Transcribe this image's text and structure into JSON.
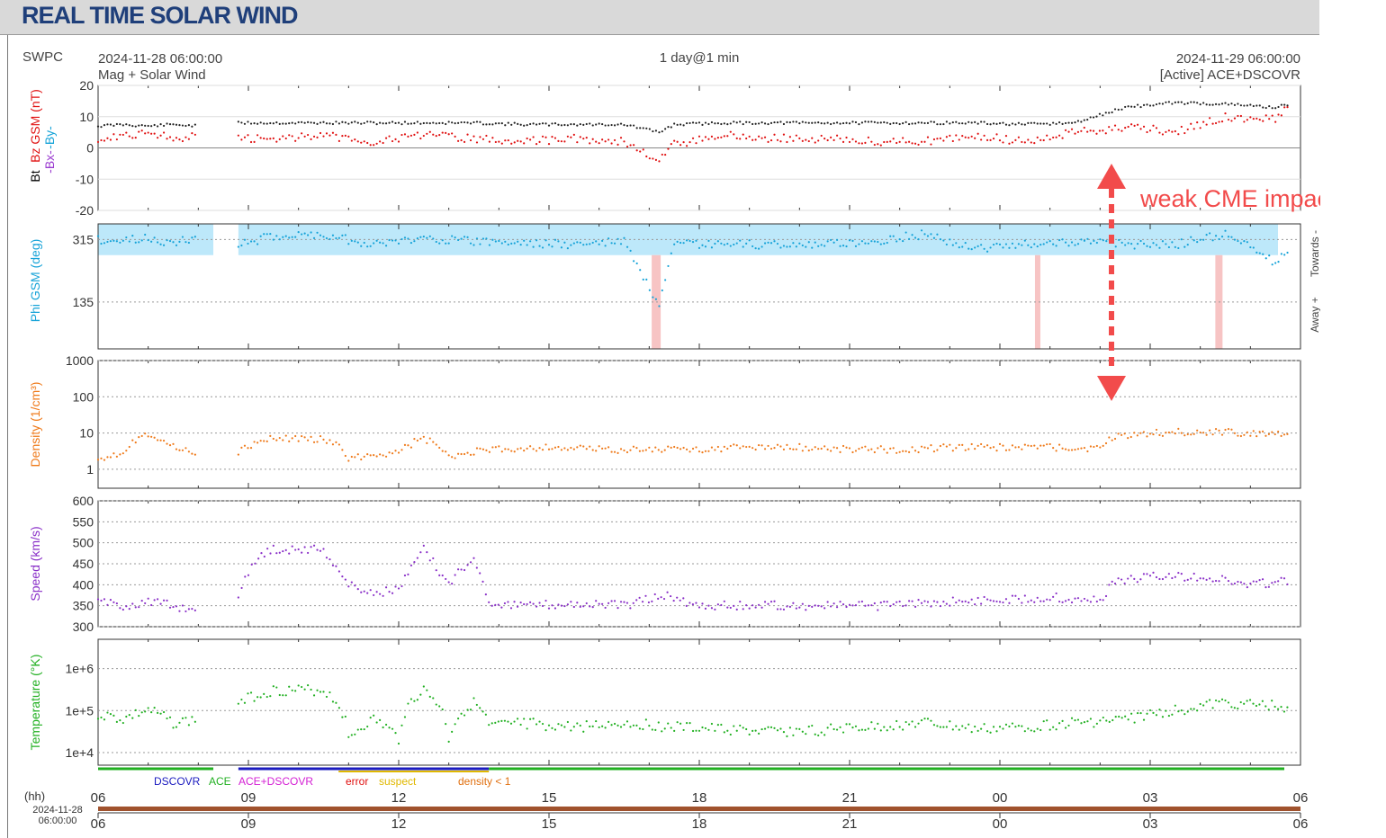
{
  "header": {
    "title": "REAL TIME SOLAR WIND"
  },
  "top": {
    "left": "SWPC",
    "start": "2024-11-28 06:00:00",
    "subtitle": "Mag + Solar Wind",
    "center": "1 day@1 min",
    "end": "2024-11-29 06:00:00",
    "source": "[Active] ACE+DSCOVR"
  },
  "annotation": {
    "text": "weak CME impact",
    "color": "#f24b4b"
  },
  "legend": [
    {
      "label": "DSCOVR",
      "color": "#1b1bbf"
    },
    {
      "label": "ACE",
      "color": "#22b022"
    },
    {
      "label": "ACE+DSCOVR",
      "color": "#d420d4"
    },
    {
      "label": "error",
      "color": "#e01010"
    },
    {
      "label": "suspect",
      "color": "#e0b800"
    },
    {
      "label": "density < 1",
      "color": "#e07010"
    }
  ],
  "xaxis": {
    "label": "(hh)",
    "ticks": [
      "06",
      "09",
      "12",
      "15",
      "18",
      "21",
      "00",
      "03",
      "06"
    ],
    "date_line1": "2024-11-28",
    "date_line2": "06:00:00"
  },
  "chart_data": [
    {
      "type": "scatter",
      "panel": "mag",
      "ylabel_parts": [
        "Bt",
        "-Bx-",
        "-By-",
        "Bz GSM (nT)"
      ],
      "ylabel_colors": [
        "#000000",
        "#9a3ad0",
        "#16a3d8",
        "#e01010"
      ],
      "yticks": [
        "20",
        "10",
        "0",
        "-10",
        "-20"
      ],
      "ylim": [
        -20,
        20
      ],
      "x": [
        6,
        6.5,
        7,
        7.5,
        8,
        8.3,
        8.8,
        9.5,
        10.5,
        11.5,
        12.5,
        13.5,
        14.5,
        15.5,
        16.5,
        17.2,
        17.5,
        18.5,
        19.5,
        20.5,
        21.5,
        22.5,
        23.5,
        0.5,
        1.5,
        2.3,
        2.5,
        3.5,
        4.5,
        5.5,
        5.8
      ],
      "series": [
        {
          "name": "Bt",
          "color": "#222222",
          "values": [
            7,
            7.5,
            7,
            7.5,
            7,
            null,
            8,
            8,
            8,
            8,
            8,
            8,
            7.5,
            7.5,
            7.5,
            5,
            7.5,
            8,
            8,
            8,
            8,
            8,
            8,
            7.5,
            8,
            12,
            13,
            14.5,
            14,
            13,
            14
          ]
        },
        {
          "name": "Bz GSM",
          "color": "#e01010",
          "values": [
            3,
            4,
            5,
            3,
            4,
            null,
            3,
            3,
            4,
            2,
            4,
            3,
            2,
            3,
            2,
            -4,
            1,
            4,
            3,
            3,
            2,
            2,
            4,
            2,
            5,
            6,
            7,
            5,
            10,
            9,
            14
          ]
        }
      ]
    },
    {
      "type": "scatter",
      "panel": "phi",
      "ylabel": "Phi GSM (deg)",
      "right_label_top": "Towards -",
      "right_label_bottom": "Away +",
      "yticks": [
        "315",
        "135"
      ],
      "x": [
        6,
        6.5,
        7,
        7.5,
        8,
        8.3,
        8.8,
        9.5,
        10.5,
        11.5,
        12.5,
        13.5,
        14.5,
        15.5,
        16.5,
        17.2,
        17.5,
        18.5,
        19.5,
        20.5,
        21.5,
        22.5,
        23.5,
        0.5,
        1.5,
        2.5,
        3.5,
        4.5,
        5.5,
        5.8
      ],
      "values": [
        315,
        310,
        320,
        305,
        320,
        null,
        300,
        325,
        330,
        300,
        320,
        310,
        305,
        300,
        310,
        120,
        300,
        300,
        300,
        300,
        310,
        330,
        290,
        300,
        310,
        300,
        300,
        330,
        250,
        300
      ]
    },
    {
      "type": "scatter",
      "panel": "density",
      "ylabel": "Density (1/cm³)",
      "yscale": "log",
      "yticks": [
        "1000",
        "100",
        "10",
        "1"
      ],
      "ylim": [
        0.3,
        1000
      ],
      "color": "#ef7a1a",
      "x": [
        6,
        6.5,
        7,
        7.5,
        8,
        8.3,
        8.8,
        9.5,
        10.5,
        11,
        12,
        12.5,
        13,
        13.5,
        14,
        15,
        16,
        17,
        18,
        19,
        20,
        21,
        22,
        23,
        0,
        1,
        2,
        2.3,
        3,
        4,
        5,
        5.8
      ],
      "values": [
        2,
        3,
        10,
        4,
        3,
        null,
        3,
        7,
        7,
        2,
        3,
        7,
        2,
        3,
        3.5,
        4,
        3.5,
        3.5,
        3.5,
        4,
        4,
        3.5,
        3.5,
        4,
        4,
        4,
        3.5,
        8,
        10,
        11,
        10,
        9
      ]
    },
    {
      "type": "scatter",
      "panel": "speed",
      "ylabel": "Speed (km/s)",
      "yticks": [
        "600",
        "550",
        "500",
        "450",
        "400",
        "350",
        "300"
      ],
      "ylim": [
        300,
        600
      ],
      "color": "#8a30c8",
      "x": [
        6,
        6.5,
        7,
        7.5,
        8,
        8.3,
        8.8,
        9.2,
        9.5,
        10,
        10.5,
        11,
        11.5,
        12,
        12.5,
        13,
        13.5,
        13.8,
        14.5,
        15.5,
        16.5,
        17.3,
        18,
        19,
        20,
        21,
        22,
        23,
        0,
        1,
        2,
        2.3,
        3,
        4,
        4.5,
        5,
        5.8
      ],
      "values": [
        360,
        350,
        360,
        350,
        340,
        null,
        380,
        470,
        485,
        485,
        485,
        400,
        380,
        390,
        485,
        400,
        470,
        360,
        350,
        355,
        350,
        375,
        350,
        350,
        350,
        350,
        350,
        360,
        365,
        370,
        360,
        410,
        420,
        420,
        410,
        400,
        410
      ]
    },
    {
      "type": "scatter",
      "panel": "temperature",
      "ylabel": "Temperature (°K)",
      "yscale": "log",
      "yticks": [
        "1e+6",
        "1e+5",
        "1e+4"
      ],
      "color": "#22b022",
      "x": [
        6,
        6.5,
        7,
        7.5,
        8,
        8.3,
        8.8,
        9.5,
        10.5,
        11,
        11.5,
        12,
        12.5,
        13,
        13.5,
        13.8,
        14.5,
        15.5,
        16.5,
        17.5,
        18.5,
        19.5,
        20.5,
        21.5,
        22.5,
        23.5,
        0.5,
        1.5,
        2.5,
        3.5,
        4.5,
        5.8
      ],
      "values": [
        80000,
        60000,
        100000,
        50000,
        60000,
        null,
        150000,
        300000,
        300000,
        20000,
        60000,
        20000,
        300000,
        20000,
        150000,
        40000,
        50000,
        40000,
        50000,
        40000,
        35000,
        30000,
        35000,
        40000,
        50000,
        35000,
        40000,
        50000,
        60000,
        100000,
        150000,
        120000
      ]
    }
  ]
}
